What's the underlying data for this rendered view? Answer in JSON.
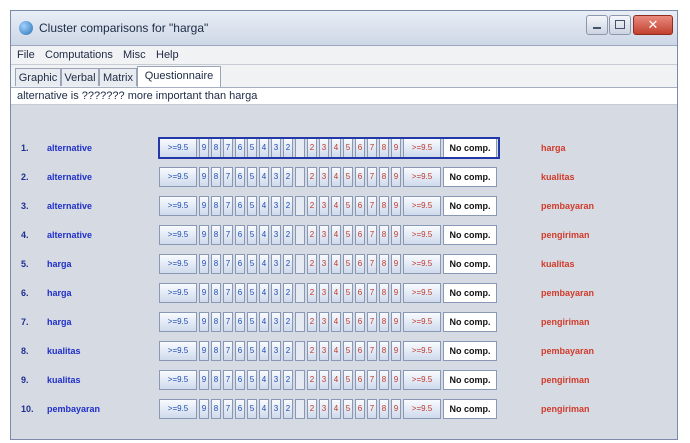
{
  "window": {
    "title": "Cluster comparisons for \"harga\""
  },
  "menu": [
    "File",
    "Computations",
    "Misc",
    "Help"
  ],
  "tabs": [
    {
      "label": "Graphic",
      "active": false
    },
    {
      "label": "Verbal",
      "active": false
    },
    {
      "label": "Matrix",
      "active": false
    },
    {
      "label": "Questionnaire",
      "active": true
    }
  ],
  "instruction": "alternative is ??????? more important than  harga",
  "scale": {
    "left_end": ">=9.5",
    "left": [
      "9",
      "8",
      "7",
      "6",
      "5",
      "4",
      "3",
      "2"
    ],
    "right": [
      "2",
      "3",
      "4",
      "5",
      "6",
      "7",
      "8",
      "9"
    ],
    "right_end": ">=9.5",
    "no_comp": "No comp."
  },
  "rows": [
    {
      "num": "1.",
      "left": "alternative",
      "right": "harga"
    },
    {
      "num": "2.",
      "left": "alternative",
      "right": "kualitas"
    },
    {
      "num": "3.",
      "left": "alternative",
      "right": "pembayaran"
    },
    {
      "num": "4.",
      "left": "alternative",
      "right": "pengiriman"
    },
    {
      "num": "5.",
      "left": "harga",
      "right": "kualitas"
    },
    {
      "num": "6.",
      "left": "harga",
      "right": "pembayaran"
    },
    {
      "num": "7.",
      "left": "harga",
      "right": "pengiriman"
    },
    {
      "num": "8.",
      "left": "kualitas",
      "right": "pembayaran"
    },
    {
      "num": "9.",
      "left": "kualitas",
      "right": "pengiriman"
    },
    {
      "num": "10.",
      "left": "pembayaran",
      "right": "pengiriman"
    }
  ]
}
